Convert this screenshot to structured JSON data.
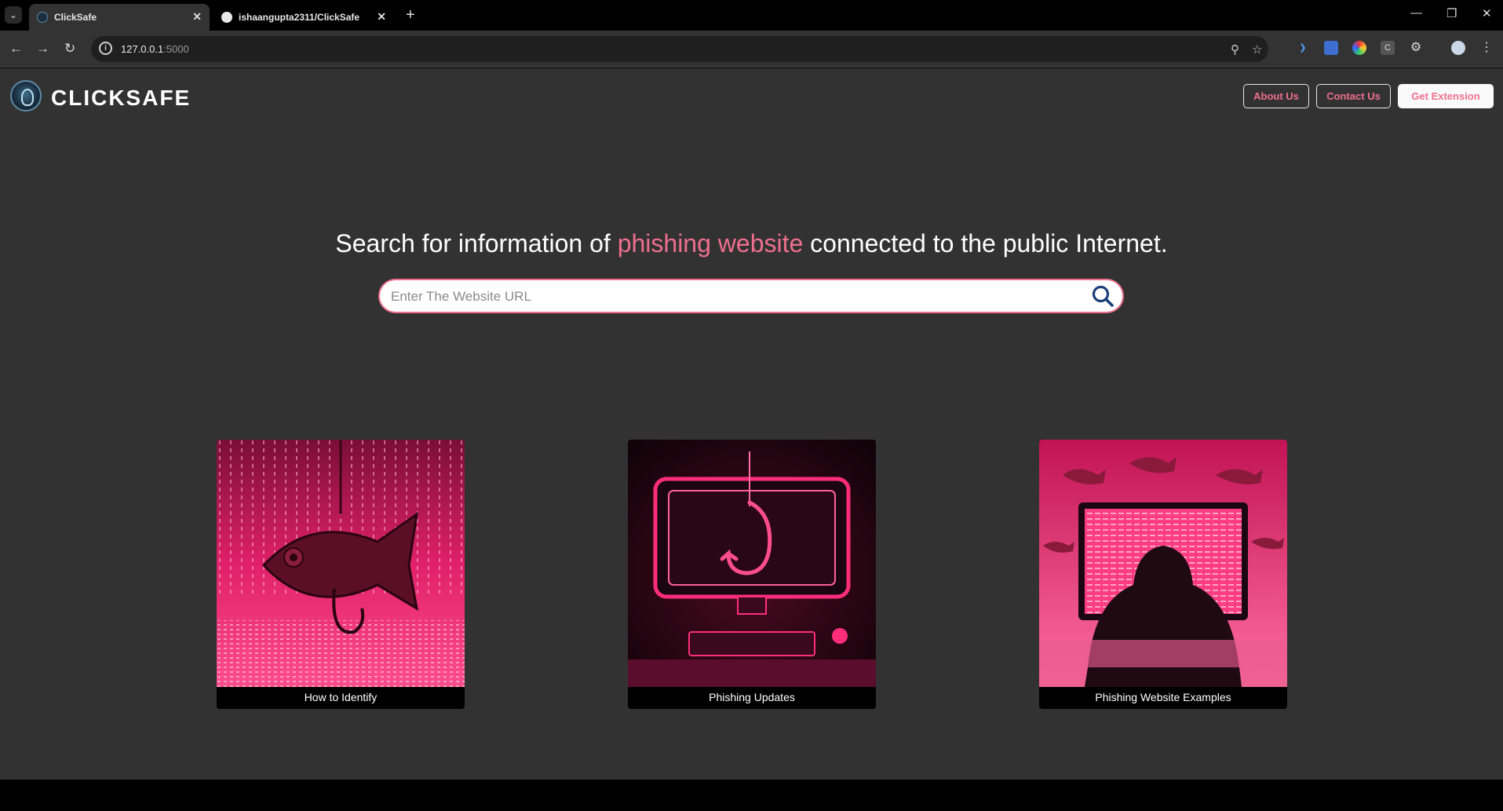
{
  "browser": {
    "tabs": [
      {
        "title": "ClickSafe",
        "active": true
      },
      {
        "title": "ishaangupta2311/ClickSafe",
        "active": false
      }
    ],
    "url_host": "127.0.0.1",
    "url_port": ":5000"
  },
  "header": {
    "brand": "CLICKSAFE",
    "buttons": {
      "about": "About Us",
      "contact": "Contact Us",
      "extension": "Get Extension"
    }
  },
  "hero": {
    "headline_prefix": "Search for information of ",
    "headline_accent": "phishing website",
    "headline_suffix": " connected to the public Internet.",
    "search_placeholder": "Enter The Website URL"
  },
  "cards": [
    {
      "label": "How to Identify",
      "image_icon": "fish-on-hook-matrix-image"
    },
    {
      "label": "Phishing Updates",
      "image_icon": "monitor-with-hook-image"
    },
    {
      "label": "Phishing Website Examples",
      "image_icon": "hooded-hacker-image"
    }
  ],
  "colors": {
    "accent": "#ef6f8d",
    "page_bg": "#323232",
    "search_icon": "#1c3f7a"
  }
}
